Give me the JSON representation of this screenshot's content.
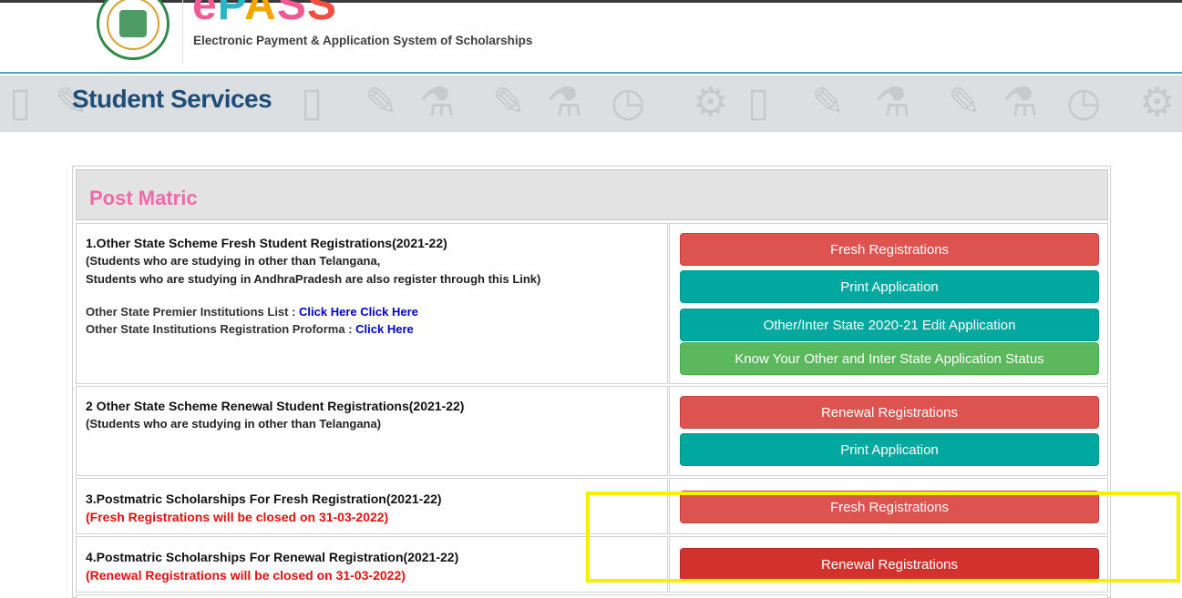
{
  "header": {
    "logo": {
      "e": "e",
      "p": "P",
      "a": "A",
      "s1": "S",
      "s2": "S"
    },
    "subtitle": "Electronic Payment & Application System of Scholarships"
  },
  "banner": {
    "title": "Student Services"
  },
  "panel": {
    "title": "Post Matric"
  },
  "rows": [
    {
      "heading": "1.Other State Scheme Fresh Student Registrations(2021-22)",
      "note1": "(Students who are studying in other than Telangana,",
      "note2": "Students who are studying in AndhraPradesh are also register through this Link)",
      "premier_label": "Other State Premier Institutions List : ",
      "premier_link1": "Click Here",
      "premier_link2": "Click Here",
      "proforma_label": "Other State Institutions Registration Proforma : ",
      "proforma_link": "Click Here",
      "buttons": [
        "Fresh Registrations",
        "Print Application",
        "Other/Inter State 2020-21 Edit Application",
        "Know Your Other and Inter State Application Status"
      ]
    },
    {
      "heading": "2 Other State Scheme Renewal Student Registrations(2021-22)",
      "note1": "(Students who are studying in other than Telangana)",
      "buttons": [
        "Renewal Registrations",
        "Print Application"
      ]
    },
    {
      "heading": "3.Postmatric Scholarships For Fresh Registration(2021-22)",
      "notice": "(Fresh Registrations will be closed on 31-03-2022)",
      "buttons": [
        "Fresh Registrations"
      ]
    },
    {
      "heading": "4.Postmatric Scholarships For Renewal Registration(2021-22)",
      "notice": "(Renewal Registrations will be closed on 31-03-2022)",
      "buttons": [
        "Renewal Registrations"
      ]
    }
  ],
  "colors": {
    "red": "#dc534f",
    "dark_red": "#d2322d",
    "teal": "#00a8a0",
    "green": "#5cb85c",
    "highlight": "#f7ef00"
  }
}
